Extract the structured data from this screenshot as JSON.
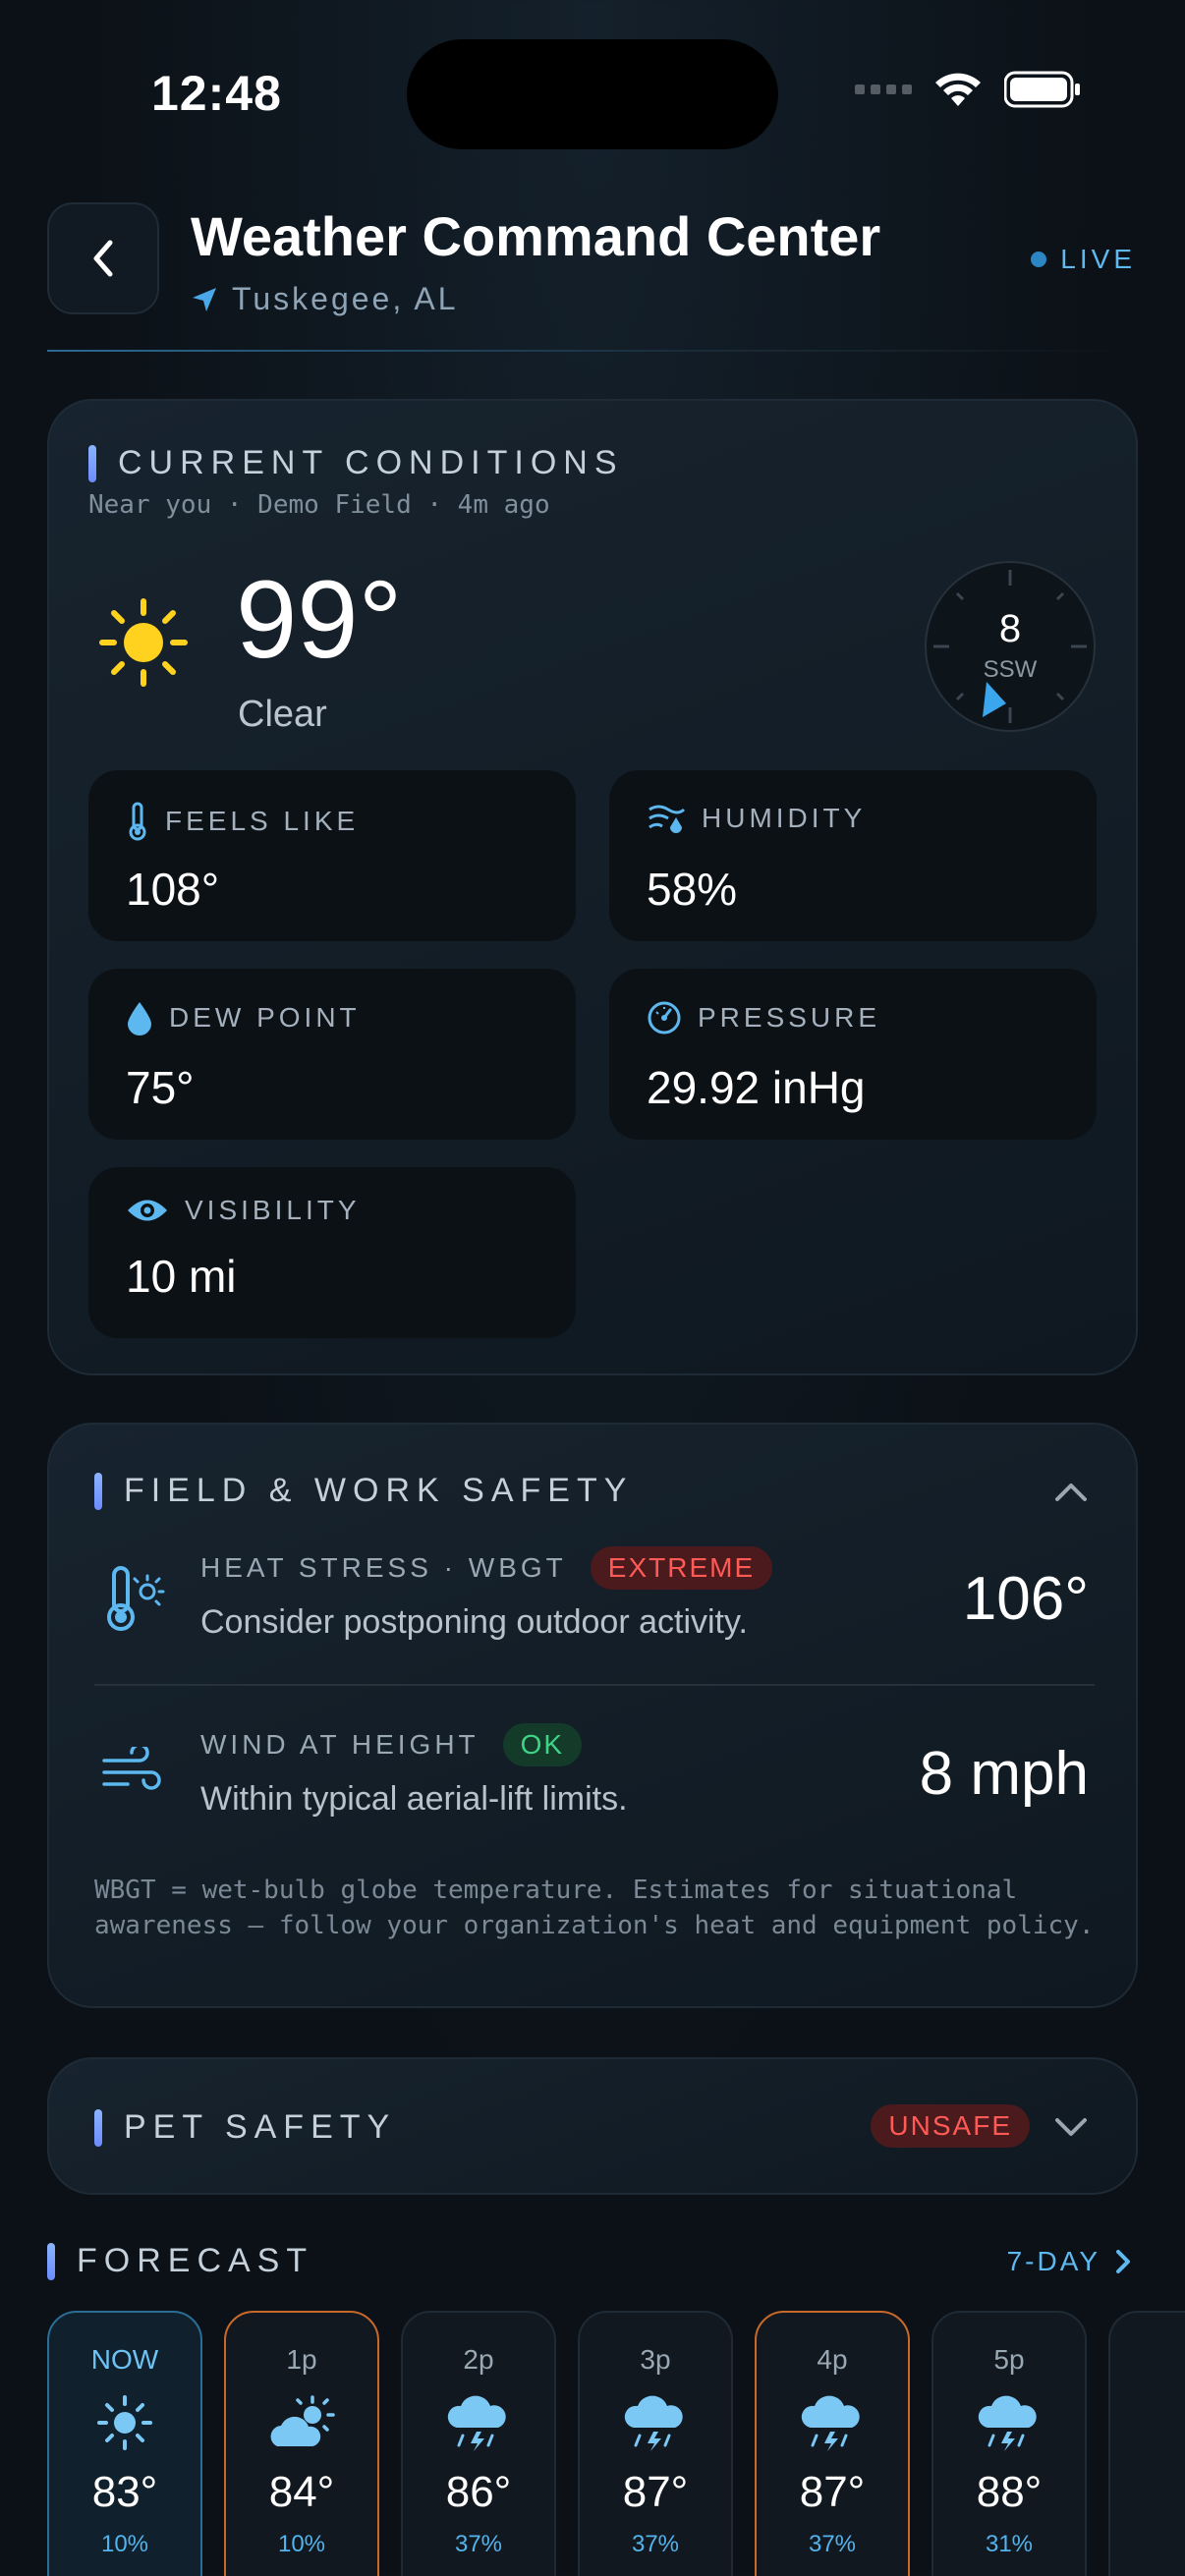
{
  "status": {
    "time": "12:48"
  },
  "header": {
    "title": "Weather Command Center",
    "location": "Tuskegee, AL",
    "live": "LIVE"
  },
  "current": {
    "section_title": "CURRENT CONDITIONS",
    "subtitle": "Near you · Demo Field · 4m ago",
    "temp": "99°",
    "condition": "Clear",
    "wind_speed": "8",
    "wind_dir": "SSW",
    "tiles": [
      {
        "icon": "thermometer-icon",
        "label": "FEELS LIKE",
        "value": "108°"
      },
      {
        "icon": "humidity-icon",
        "label": "HUMIDITY",
        "value": "58%"
      },
      {
        "icon": "droplet-icon",
        "label": "DEW POINT",
        "value": "75°"
      },
      {
        "icon": "gauge-icon",
        "label": "PRESSURE",
        "value": "29.92 inHg"
      },
      {
        "icon": "eye-icon",
        "label": "VISIBILITY",
        "value": "10 mi"
      }
    ]
  },
  "field_safety": {
    "section_title": "FIELD & WORK SAFETY",
    "heat": {
      "label": "HEAT STRESS · WBGT",
      "badge": "EXTREME",
      "text": "Consider postponing outdoor activity.",
      "value": "106°"
    },
    "wind": {
      "label": "WIND AT HEIGHT",
      "badge": "OK",
      "text": "Within typical aerial-lift limits.",
      "value": "8 mph"
    },
    "note": "WBGT = wet-bulb globe temperature. Estimates for situational awareness — follow your organization's heat and equipment policy."
  },
  "pet_safety": {
    "section_title": "PET SAFETY",
    "badge": "UNSAFE"
  },
  "forecast": {
    "section_title": "FORECAST",
    "link": "7-DAY",
    "hours": [
      {
        "time": "NOW",
        "icon": "sun-icon",
        "temp": "83°",
        "pop": "10%"
      },
      {
        "time": "1p",
        "icon": "partly-cloudy-icon",
        "temp": "84°",
        "pop": "10%"
      },
      {
        "time": "2p",
        "icon": "thunderstorm-icon",
        "temp": "86°",
        "pop": "37%"
      },
      {
        "time": "3p",
        "icon": "thunderstorm-icon",
        "temp": "87°",
        "pop": "37%"
      },
      {
        "time": "4p",
        "icon": "thunderstorm-icon",
        "temp": "87°",
        "pop": "37%"
      },
      {
        "time": "5p",
        "icon": "thunderstorm-icon",
        "temp": "88°",
        "pop": "31%"
      }
    ]
  },
  "colors": {
    "accent": "#5fb8ee",
    "sun": "#ffd21f",
    "danger": "#ff5a55",
    "ok": "#3ed486",
    "warn_border": "#c8692a"
  }
}
